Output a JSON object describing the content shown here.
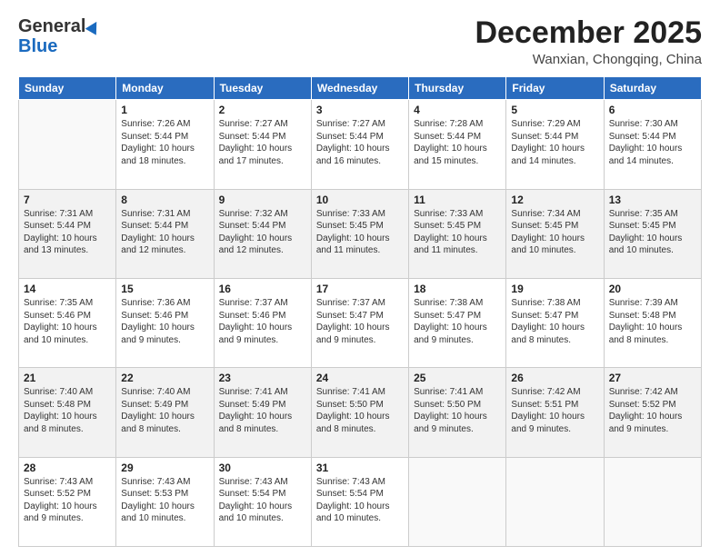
{
  "logo": {
    "general": "General",
    "blue": "Blue"
  },
  "header": {
    "month_year": "December 2025",
    "location": "Wanxian, Chongqing, China"
  },
  "days_of_week": [
    "Sunday",
    "Monday",
    "Tuesday",
    "Wednesday",
    "Thursday",
    "Friday",
    "Saturday"
  ],
  "weeks": [
    [
      {
        "day": "",
        "info": ""
      },
      {
        "day": "1",
        "info": "Sunrise: 7:26 AM\nSunset: 5:44 PM\nDaylight: 10 hours\nand 18 minutes."
      },
      {
        "day": "2",
        "info": "Sunrise: 7:27 AM\nSunset: 5:44 PM\nDaylight: 10 hours\nand 17 minutes."
      },
      {
        "day": "3",
        "info": "Sunrise: 7:27 AM\nSunset: 5:44 PM\nDaylight: 10 hours\nand 16 minutes."
      },
      {
        "day": "4",
        "info": "Sunrise: 7:28 AM\nSunset: 5:44 PM\nDaylight: 10 hours\nand 15 minutes."
      },
      {
        "day": "5",
        "info": "Sunrise: 7:29 AM\nSunset: 5:44 PM\nDaylight: 10 hours\nand 14 minutes."
      },
      {
        "day": "6",
        "info": "Sunrise: 7:30 AM\nSunset: 5:44 PM\nDaylight: 10 hours\nand 14 minutes."
      }
    ],
    [
      {
        "day": "7",
        "info": "Sunrise: 7:31 AM\nSunset: 5:44 PM\nDaylight: 10 hours\nand 13 minutes."
      },
      {
        "day": "8",
        "info": "Sunrise: 7:31 AM\nSunset: 5:44 PM\nDaylight: 10 hours\nand 12 minutes."
      },
      {
        "day": "9",
        "info": "Sunrise: 7:32 AM\nSunset: 5:44 PM\nDaylight: 10 hours\nand 12 minutes."
      },
      {
        "day": "10",
        "info": "Sunrise: 7:33 AM\nSunset: 5:45 PM\nDaylight: 10 hours\nand 11 minutes."
      },
      {
        "day": "11",
        "info": "Sunrise: 7:33 AM\nSunset: 5:45 PM\nDaylight: 10 hours\nand 11 minutes."
      },
      {
        "day": "12",
        "info": "Sunrise: 7:34 AM\nSunset: 5:45 PM\nDaylight: 10 hours\nand 10 minutes."
      },
      {
        "day": "13",
        "info": "Sunrise: 7:35 AM\nSunset: 5:45 PM\nDaylight: 10 hours\nand 10 minutes."
      }
    ],
    [
      {
        "day": "14",
        "info": "Sunrise: 7:35 AM\nSunset: 5:46 PM\nDaylight: 10 hours\nand 10 minutes."
      },
      {
        "day": "15",
        "info": "Sunrise: 7:36 AM\nSunset: 5:46 PM\nDaylight: 10 hours\nand 9 minutes."
      },
      {
        "day": "16",
        "info": "Sunrise: 7:37 AM\nSunset: 5:46 PM\nDaylight: 10 hours\nand 9 minutes."
      },
      {
        "day": "17",
        "info": "Sunrise: 7:37 AM\nSunset: 5:47 PM\nDaylight: 10 hours\nand 9 minutes."
      },
      {
        "day": "18",
        "info": "Sunrise: 7:38 AM\nSunset: 5:47 PM\nDaylight: 10 hours\nand 9 minutes."
      },
      {
        "day": "19",
        "info": "Sunrise: 7:38 AM\nSunset: 5:47 PM\nDaylight: 10 hours\nand 8 minutes."
      },
      {
        "day": "20",
        "info": "Sunrise: 7:39 AM\nSunset: 5:48 PM\nDaylight: 10 hours\nand 8 minutes."
      }
    ],
    [
      {
        "day": "21",
        "info": "Sunrise: 7:40 AM\nSunset: 5:48 PM\nDaylight: 10 hours\nand 8 minutes."
      },
      {
        "day": "22",
        "info": "Sunrise: 7:40 AM\nSunset: 5:49 PM\nDaylight: 10 hours\nand 8 minutes."
      },
      {
        "day": "23",
        "info": "Sunrise: 7:41 AM\nSunset: 5:49 PM\nDaylight: 10 hours\nand 8 minutes."
      },
      {
        "day": "24",
        "info": "Sunrise: 7:41 AM\nSunset: 5:50 PM\nDaylight: 10 hours\nand 8 minutes."
      },
      {
        "day": "25",
        "info": "Sunrise: 7:41 AM\nSunset: 5:50 PM\nDaylight: 10 hours\nand 9 minutes."
      },
      {
        "day": "26",
        "info": "Sunrise: 7:42 AM\nSunset: 5:51 PM\nDaylight: 10 hours\nand 9 minutes."
      },
      {
        "day": "27",
        "info": "Sunrise: 7:42 AM\nSunset: 5:52 PM\nDaylight: 10 hours\nand 9 minutes."
      }
    ],
    [
      {
        "day": "28",
        "info": "Sunrise: 7:43 AM\nSunset: 5:52 PM\nDaylight: 10 hours\nand 9 minutes."
      },
      {
        "day": "29",
        "info": "Sunrise: 7:43 AM\nSunset: 5:53 PM\nDaylight: 10 hours\nand 10 minutes."
      },
      {
        "day": "30",
        "info": "Sunrise: 7:43 AM\nSunset: 5:54 PM\nDaylight: 10 hours\nand 10 minutes."
      },
      {
        "day": "31",
        "info": "Sunrise: 7:43 AM\nSunset: 5:54 PM\nDaylight: 10 hours\nand 10 minutes."
      },
      {
        "day": "",
        "info": ""
      },
      {
        "day": "",
        "info": ""
      },
      {
        "day": "",
        "info": ""
      }
    ]
  ]
}
